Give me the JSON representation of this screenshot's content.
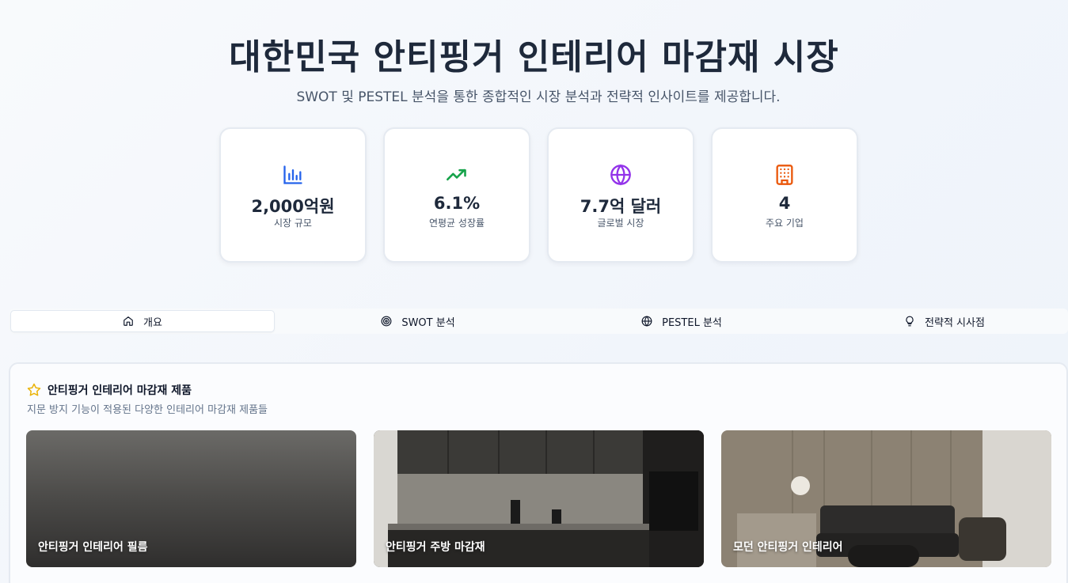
{
  "header": {
    "title": "대한민국 안티핑거 인테리어 마감재 시장",
    "subtitle": "SWOT 및 PESTEL 분석을 통한 종합적인 시장 분석과 전략적 인사이트를 제공합니다."
  },
  "stats": [
    {
      "icon": "bar-chart-icon",
      "value": "2,000억원",
      "label": "시장 규모",
      "color": "#2563eb"
    },
    {
      "icon": "trending-up-icon",
      "value": "6.1%",
      "label": "연평균 성장률",
      "color": "#16a34a"
    },
    {
      "icon": "globe-icon",
      "value": "7.7억 달러",
      "label": "글로벌 시장",
      "color": "#9333ea"
    },
    {
      "icon": "building-icon",
      "value": "4",
      "label": "주요 기업",
      "color": "#ea580c"
    }
  ],
  "tabs": [
    {
      "icon": "home-icon",
      "label": "개요",
      "active": true
    },
    {
      "icon": "target-icon",
      "label": "SWOT 분석",
      "active": false
    },
    {
      "icon": "globe-icon",
      "label": "PESTEL 분석",
      "active": false
    },
    {
      "icon": "lightbulb-icon",
      "label": "전략적 시사점",
      "active": false
    }
  ],
  "products_panel": {
    "icon": "star-icon",
    "title": "안티핑거 인테리어 마감재 제품",
    "description": "지문 방지 기능이 적용된 다양한 인테리어 마감재 제품들",
    "accent": "#eab308",
    "items": [
      {
        "label": "안티핑거 인테리어 필름"
      },
      {
        "label": "안티핑거 주방 마감재"
      },
      {
        "label": "모던 안티핑거 인테리어"
      }
    ]
  }
}
